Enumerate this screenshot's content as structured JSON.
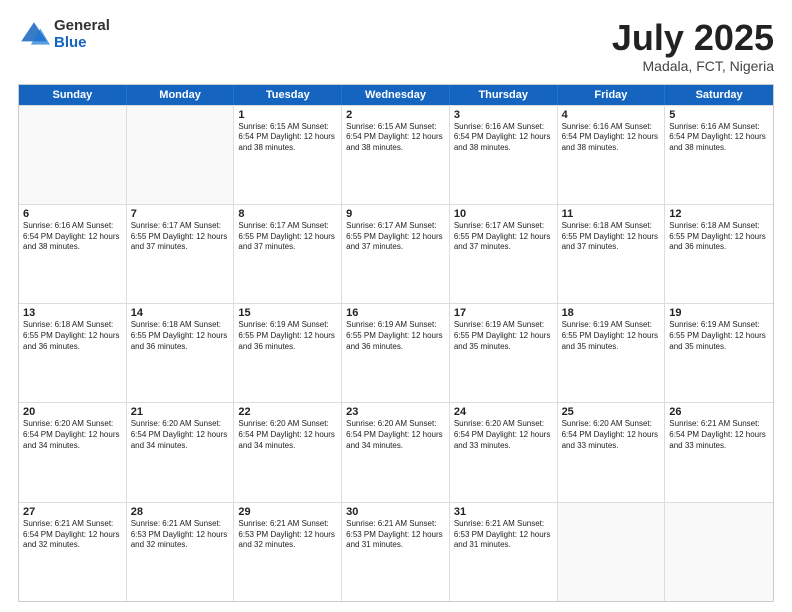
{
  "logo": {
    "general": "General",
    "blue": "Blue"
  },
  "header": {
    "month": "July 2025",
    "location": "Madala, FCT, Nigeria"
  },
  "weekdays": [
    "Sunday",
    "Monday",
    "Tuesday",
    "Wednesday",
    "Thursday",
    "Friday",
    "Saturday"
  ],
  "rows": [
    [
      {
        "day": "",
        "detail": ""
      },
      {
        "day": "",
        "detail": ""
      },
      {
        "day": "1",
        "detail": "Sunrise: 6:15 AM\nSunset: 6:54 PM\nDaylight: 12 hours\nand 38 minutes."
      },
      {
        "day": "2",
        "detail": "Sunrise: 6:15 AM\nSunset: 6:54 PM\nDaylight: 12 hours\nand 38 minutes."
      },
      {
        "day": "3",
        "detail": "Sunrise: 6:16 AM\nSunset: 6:54 PM\nDaylight: 12 hours\nand 38 minutes."
      },
      {
        "day": "4",
        "detail": "Sunrise: 6:16 AM\nSunset: 6:54 PM\nDaylight: 12 hours\nand 38 minutes."
      },
      {
        "day": "5",
        "detail": "Sunrise: 6:16 AM\nSunset: 6:54 PM\nDaylight: 12 hours\nand 38 minutes."
      }
    ],
    [
      {
        "day": "6",
        "detail": "Sunrise: 6:16 AM\nSunset: 6:54 PM\nDaylight: 12 hours\nand 38 minutes."
      },
      {
        "day": "7",
        "detail": "Sunrise: 6:17 AM\nSunset: 6:55 PM\nDaylight: 12 hours\nand 37 minutes."
      },
      {
        "day": "8",
        "detail": "Sunrise: 6:17 AM\nSunset: 6:55 PM\nDaylight: 12 hours\nand 37 minutes."
      },
      {
        "day": "9",
        "detail": "Sunrise: 6:17 AM\nSunset: 6:55 PM\nDaylight: 12 hours\nand 37 minutes."
      },
      {
        "day": "10",
        "detail": "Sunrise: 6:17 AM\nSunset: 6:55 PM\nDaylight: 12 hours\nand 37 minutes."
      },
      {
        "day": "11",
        "detail": "Sunrise: 6:18 AM\nSunset: 6:55 PM\nDaylight: 12 hours\nand 37 minutes."
      },
      {
        "day": "12",
        "detail": "Sunrise: 6:18 AM\nSunset: 6:55 PM\nDaylight: 12 hours\nand 36 minutes."
      }
    ],
    [
      {
        "day": "13",
        "detail": "Sunrise: 6:18 AM\nSunset: 6:55 PM\nDaylight: 12 hours\nand 36 minutes."
      },
      {
        "day": "14",
        "detail": "Sunrise: 6:18 AM\nSunset: 6:55 PM\nDaylight: 12 hours\nand 36 minutes."
      },
      {
        "day": "15",
        "detail": "Sunrise: 6:19 AM\nSunset: 6:55 PM\nDaylight: 12 hours\nand 36 minutes."
      },
      {
        "day": "16",
        "detail": "Sunrise: 6:19 AM\nSunset: 6:55 PM\nDaylight: 12 hours\nand 36 minutes."
      },
      {
        "day": "17",
        "detail": "Sunrise: 6:19 AM\nSunset: 6:55 PM\nDaylight: 12 hours\nand 35 minutes."
      },
      {
        "day": "18",
        "detail": "Sunrise: 6:19 AM\nSunset: 6:55 PM\nDaylight: 12 hours\nand 35 minutes."
      },
      {
        "day": "19",
        "detail": "Sunrise: 6:19 AM\nSunset: 6:55 PM\nDaylight: 12 hours\nand 35 minutes."
      }
    ],
    [
      {
        "day": "20",
        "detail": "Sunrise: 6:20 AM\nSunset: 6:54 PM\nDaylight: 12 hours\nand 34 minutes."
      },
      {
        "day": "21",
        "detail": "Sunrise: 6:20 AM\nSunset: 6:54 PM\nDaylight: 12 hours\nand 34 minutes."
      },
      {
        "day": "22",
        "detail": "Sunrise: 6:20 AM\nSunset: 6:54 PM\nDaylight: 12 hours\nand 34 minutes."
      },
      {
        "day": "23",
        "detail": "Sunrise: 6:20 AM\nSunset: 6:54 PM\nDaylight: 12 hours\nand 34 minutes."
      },
      {
        "day": "24",
        "detail": "Sunrise: 6:20 AM\nSunset: 6:54 PM\nDaylight: 12 hours\nand 33 minutes."
      },
      {
        "day": "25",
        "detail": "Sunrise: 6:20 AM\nSunset: 6:54 PM\nDaylight: 12 hours\nand 33 minutes."
      },
      {
        "day": "26",
        "detail": "Sunrise: 6:21 AM\nSunset: 6:54 PM\nDaylight: 12 hours\nand 33 minutes."
      }
    ],
    [
      {
        "day": "27",
        "detail": "Sunrise: 6:21 AM\nSunset: 6:54 PM\nDaylight: 12 hours\nand 32 minutes."
      },
      {
        "day": "28",
        "detail": "Sunrise: 6:21 AM\nSunset: 6:53 PM\nDaylight: 12 hours\nand 32 minutes."
      },
      {
        "day": "29",
        "detail": "Sunrise: 6:21 AM\nSunset: 6:53 PM\nDaylight: 12 hours\nand 32 minutes."
      },
      {
        "day": "30",
        "detail": "Sunrise: 6:21 AM\nSunset: 6:53 PM\nDaylight: 12 hours\nand 31 minutes."
      },
      {
        "day": "31",
        "detail": "Sunrise: 6:21 AM\nSunset: 6:53 PM\nDaylight: 12 hours\nand 31 minutes."
      },
      {
        "day": "",
        "detail": ""
      },
      {
        "day": "",
        "detail": ""
      }
    ]
  ]
}
